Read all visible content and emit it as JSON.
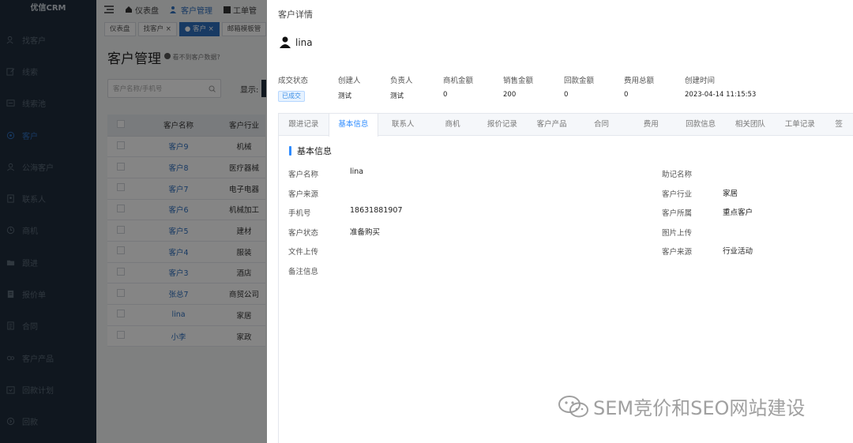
{
  "app": {
    "logo": "优信CRM"
  },
  "sidebar": {
    "items": [
      {
        "label": "找客户",
        "icon": "person-search-icon",
        "active": false
      },
      {
        "label": "线索",
        "icon": "edit-icon",
        "active": false
      },
      {
        "label": "线索池",
        "icon": "list-icon",
        "active": false
      },
      {
        "label": "客户",
        "icon": "customer-icon",
        "active": true
      },
      {
        "label": "公海客户",
        "icon": "person-icon",
        "active": false
      },
      {
        "label": "联系人",
        "icon": "contacts-icon",
        "active": false
      },
      {
        "label": "商机",
        "icon": "opportunity-icon",
        "active": false
      },
      {
        "label": "跟进",
        "icon": "folder-icon",
        "active": false
      },
      {
        "label": "报价单",
        "icon": "quote-icon",
        "active": false
      },
      {
        "label": "合同",
        "icon": "contract-icon",
        "active": false
      },
      {
        "label": "客户产品",
        "icon": "product-icon",
        "active": false
      },
      {
        "label": "回款计划",
        "icon": "plan-icon",
        "active": false
      },
      {
        "label": "回款",
        "icon": "payment-icon",
        "active": false
      }
    ]
  },
  "topnav": {
    "dashboard": "仪表盘",
    "customer_mgmt": "客户管理",
    "workorder": "工单管"
  },
  "page_tabs": [
    {
      "label": "仪表盘",
      "active": false
    },
    {
      "label": "找客户 ×",
      "active": false
    },
    {
      "label": "● 客户 ×",
      "active": true
    },
    {
      "label": "邮箱模板管",
      "active": false
    }
  ],
  "page": {
    "title": "客户管理",
    "help_text": "看不到客户数据?",
    "search_placeholder": "客户名称/手机号",
    "show_label": "显示:"
  },
  "table": {
    "headers": [
      "客户名称",
      "客户行业"
    ],
    "rows": [
      {
        "name": "客户9",
        "industry": "机械"
      },
      {
        "name": "客户8",
        "industry": "医疗器械"
      },
      {
        "name": "客户7",
        "industry": "电子电器"
      },
      {
        "name": "客户6",
        "industry": "机械加工"
      },
      {
        "name": "客户5",
        "industry": "建材"
      },
      {
        "name": "客户4",
        "industry": "服装"
      },
      {
        "name": "客户3",
        "industry": "酒店"
      },
      {
        "name": "张总7",
        "industry": "商贸公司"
      },
      {
        "name": "lina",
        "industry": "家居"
      },
      {
        "name": "小李",
        "industry": "家政"
      }
    ]
  },
  "drawer": {
    "title": "客户详情",
    "customer_name": "lina",
    "stats": [
      {
        "label": "成交状态",
        "value": "已成交",
        "badge": true
      },
      {
        "label": "创建人",
        "value": "测试"
      },
      {
        "label": "负责人",
        "value": "测试"
      },
      {
        "label": "商机金额",
        "value": "0"
      },
      {
        "label": "销售金额",
        "value": "200"
      },
      {
        "label": "回款金额",
        "value": "0"
      },
      {
        "label": "费用总额",
        "value": "0"
      },
      {
        "label": "创建时间",
        "value": "2023-04-14 11:15:53"
      }
    ],
    "tabs": [
      {
        "label": "跟进记录",
        "active": false
      },
      {
        "label": "基本信息",
        "active": true
      },
      {
        "label": "联系人",
        "active": false
      },
      {
        "label": "商机",
        "active": false
      },
      {
        "label": "报价记录",
        "active": false
      },
      {
        "label": "客户产品",
        "active": false
      },
      {
        "label": "合同",
        "active": false
      },
      {
        "label": "费用",
        "active": false
      },
      {
        "label": "回款信息",
        "active": false
      },
      {
        "label": "相关团队",
        "active": false
      },
      {
        "label": "工单记录",
        "active": false
      },
      {
        "label": "签",
        "active": false
      }
    ],
    "section_title": "基本信息",
    "left_fields": [
      {
        "label": "客户名称",
        "value": "lina"
      },
      {
        "label": "客户来源",
        "value": ""
      },
      {
        "label": "手机号",
        "value": "18631881907"
      },
      {
        "label": "客户状态",
        "value": "准备购买"
      },
      {
        "label": "文件上传",
        "value": ""
      },
      {
        "label": "备注信息",
        "value": ""
      }
    ],
    "right_fields": [
      {
        "label": "助记名称",
        "value": ""
      },
      {
        "label": "客户行业",
        "value": "家居"
      },
      {
        "label": "客户所属",
        "value": "重点客户"
      },
      {
        "label": "图片上传",
        "value": ""
      },
      {
        "label": "客户来源",
        "value": "行业活动"
      }
    ]
  },
  "watermark": "SEM竞价和SEO网站建设",
  "colors": {
    "sidebar_bg": "#1f2d3d",
    "accent": "#2f8cff",
    "badge_bg": "#e6f2ff"
  }
}
